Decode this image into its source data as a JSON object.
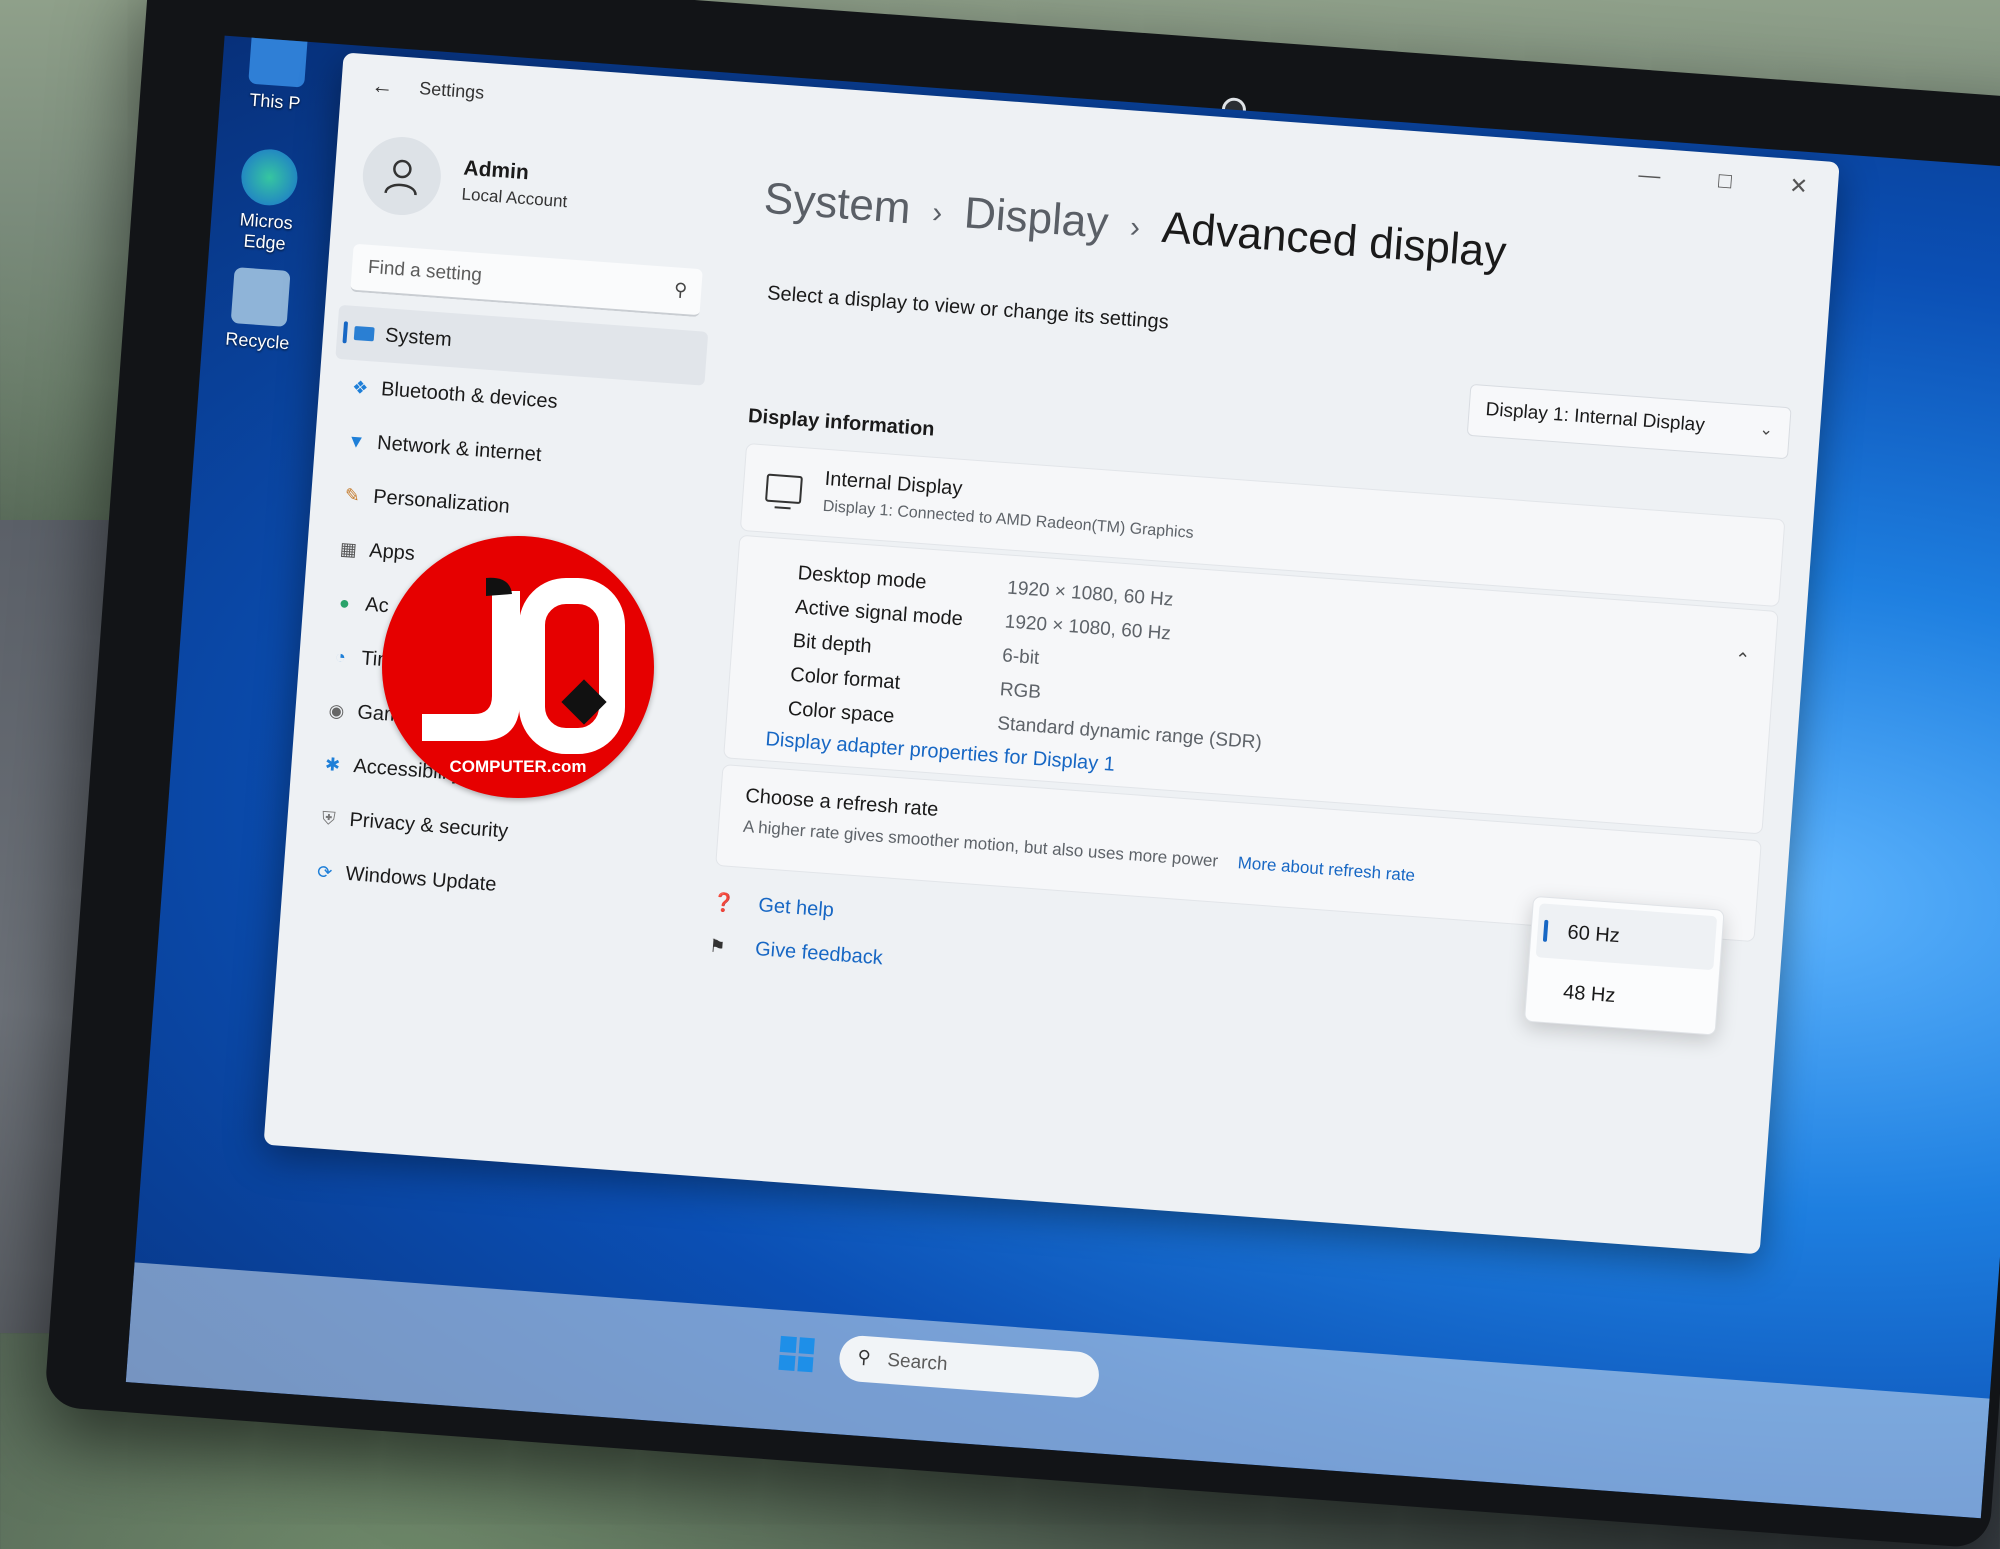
{
  "desktop": {
    "icons": [
      {
        "label": "This P"
      },
      {
        "label": "Micros Edge"
      },
      {
        "label": "Recycle"
      }
    ]
  },
  "window": {
    "app_title": "Settings",
    "controls": [
      "minimize-icon",
      "maximize-icon",
      "close-icon"
    ]
  },
  "profile": {
    "name": "Admin",
    "account_type": "Local Account"
  },
  "search": {
    "placeholder": "Find a setting"
  },
  "sidebar": {
    "items": [
      {
        "label": "System",
        "icon": "monitor-icon",
        "active": true
      },
      {
        "label": "Bluetooth & devices",
        "icon": "bluetooth-icon"
      },
      {
        "label": "Network & internet",
        "icon": "wifi-icon"
      },
      {
        "label": "Personalization",
        "icon": "brush-icon"
      },
      {
        "label": "Apps",
        "icon": "apps-icon"
      },
      {
        "label": "Ac",
        "icon": "person-icon"
      },
      {
        "label": "Tim",
        "icon": "clock-icon"
      },
      {
        "label": "Gaming",
        "icon": "gamepad-icon"
      },
      {
        "label": "Accessibility",
        "icon": "accessibility-icon"
      },
      {
        "label": "Privacy & security",
        "icon": "shield-icon"
      },
      {
        "label": "Windows Update",
        "icon": "update-icon"
      }
    ]
  },
  "breadcrumb": {
    "items": [
      "System",
      "Display",
      "Advanced display"
    ],
    "separator": "›"
  },
  "main": {
    "select_prompt": "Select a display to view or change its settings",
    "display_dropdown": "Display 1: Internal Display",
    "section_title": "Display information",
    "display_card": {
      "title": "Internal Display",
      "subtitle": "Display 1: Connected to AMD Radeon(TM) Graphics"
    },
    "details": [
      {
        "label": "Desktop mode",
        "value": "1920 × 1080, 60 Hz"
      },
      {
        "label": "Active signal mode",
        "value": "1920 × 1080, 60 Hz"
      },
      {
        "label": "Bit depth",
        "value": "6-bit"
      },
      {
        "label": "Color format",
        "value": "RGB"
      },
      {
        "label": "Color space",
        "value": "Standard dynamic range (SDR)"
      }
    ],
    "adapter_link": "Display adapter properties for Display 1",
    "refresh": {
      "title": "Choose a refresh rate",
      "subtitle": "A higher rate gives smoother motion, but also uses more power",
      "link": "More about refresh rate",
      "options": [
        "60 Hz",
        "48 Hz"
      ],
      "selected": "60 Hz"
    },
    "help": {
      "get_help": "Get help",
      "give_feedback": "Give feedback"
    }
  },
  "taskbar": {
    "search_label": "Search"
  },
  "logo": {
    "letters": "JQ",
    "text": "COMPUTER.com"
  },
  "colors": {
    "accent": "#1767c4",
    "logo_red": "#e60000"
  }
}
